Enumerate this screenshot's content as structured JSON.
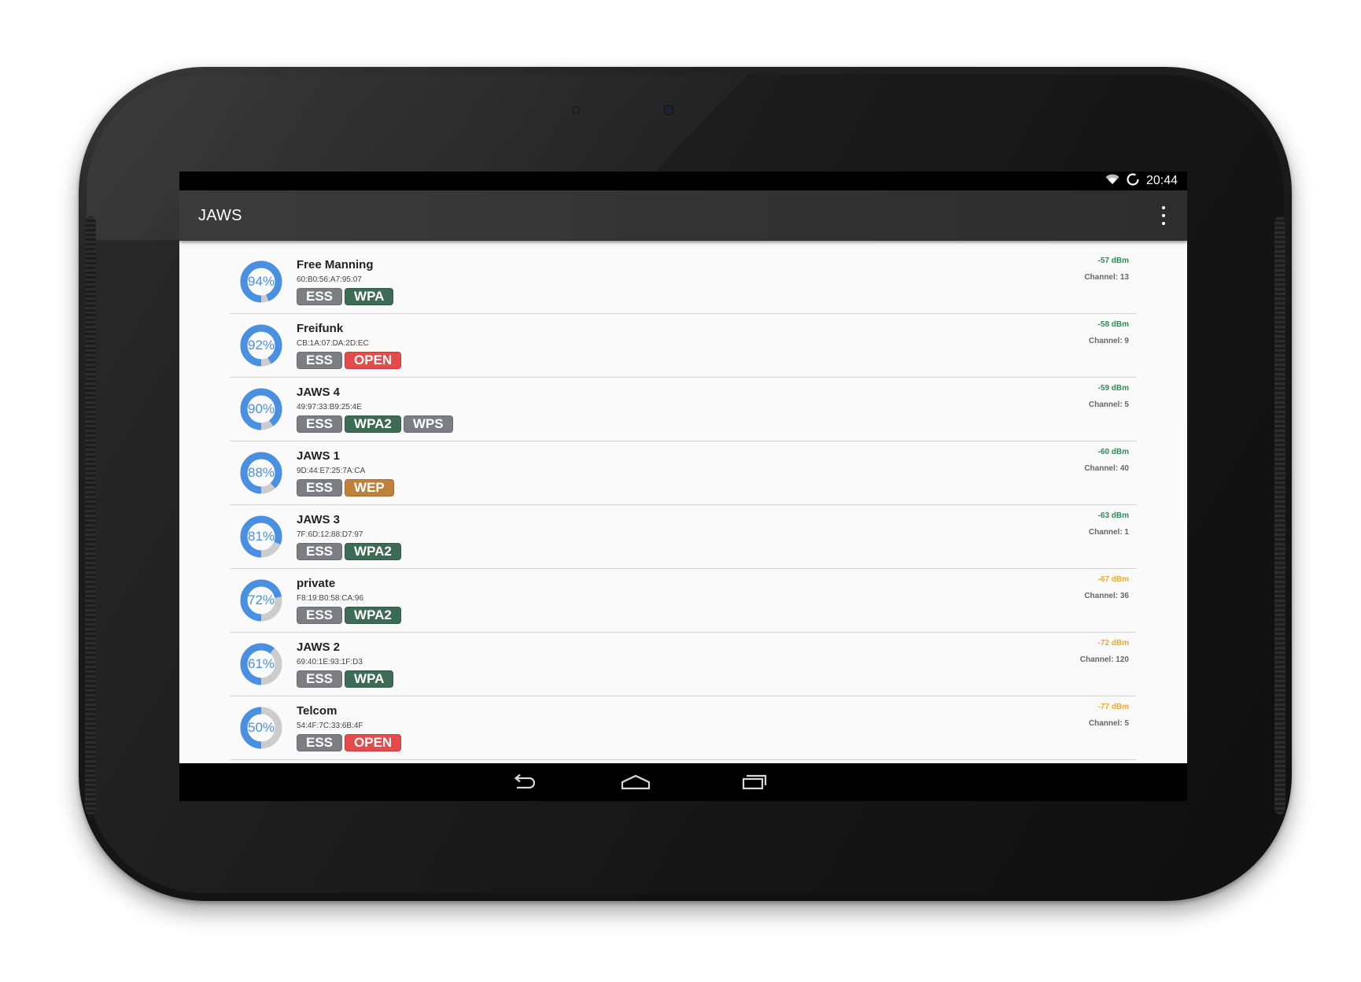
{
  "status_bar": {
    "time": "20:44"
  },
  "app": {
    "title": "JAWS"
  },
  "colors": {
    "ring_fill": "#4a90e2",
    "ring_track": "#cccccc",
    "badge_ess": "#7b7f83",
    "badge_wpa": "#3e6b55",
    "badge_wpa2": "#3e6b55",
    "badge_wps": "#7b7f83",
    "badge_open": "#e54b4b",
    "badge_wep": "#c0813a",
    "dbm_good": "#2e8b57",
    "dbm_fair": "#f0a830"
  },
  "networks": [
    {
      "ssid": "Free Manning",
      "bssid": "60:B0:56:A7:95:07",
      "signal_percent": 94,
      "signal_label": "94%",
      "dbm": "-57 dBm",
      "dbm_level": "good",
      "channel": "Channel: 13",
      "badges": [
        {
          "label": "ESS",
          "kind": "ess"
        },
        {
          "label": "WPA",
          "kind": "wpa"
        }
      ]
    },
    {
      "ssid": "Freifunk",
      "bssid": "CB:1A:07:DA:2D:EC",
      "signal_percent": 92,
      "signal_label": "92%",
      "dbm": "-58 dBm",
      "dbm_level": "good",
      "channel": "Channel: 9",
      "badges": [
        {
          "label": "ESS",
          "kind": "ess"
        },
        {
          "label": "OPEN",
          "kind": "open"
        }
      ]
    },
    {
      "ssid": "JAWS 4",
      "bssid": "49:97:33:B9:25:4E",
      "signal_percent": 90,
      "signal_label": "90%",
      "dbm": "-59 dBm",
      "dbm_level": "good",
      "channel": "Channel: 5",
      "badges": [
        {
          "label": "ESS",
          "kind": "ess"
        },
        {
          "label": "WPA2",
          "kind": "wpa2"
        },
        {
          "label": "WPS",
          "kind": "wps"
        }
      ]
    },
    {
      "ssid": "JAWS 1",
      "bssid": "9D:44:E7:25:7A:CA",
      "signal_percent": 88,
      "signal_label": "88%",
      "dbm": "-60 dBm",
      "dbm_level": "good",
      "channel": "Channel: 40",
      "badges": [
        {
          "label": "ESS",
          "kind": "ess"
        },
        {
          "label": "WEP",
          "kind": "wep"
        }
      ]
    },
    {
      "ssid": "JAWS 3",
      "bssid": "7F:6D:12:88:D7:97",
      "signal_percent": 81,
      "signal_label": "81%",
      "dbm": "-63 dBm",
      "dbm_level": "good",
      "channel": "Channel: 1",
      "badges": [
        {
          "label": "ESS",
          "kind": "ess"
        },
        {
          "label": "WPA2",
          "kind": "wpa2"
        }
      ]
    },
    {
      "ssid": "private",
      "bssid": "F8:19:B0:58:CA:96",
      "signal_percent": 72,
      "signal_label": "72%",
      "dbm": "-67 dBm",
      "dbm_level": "fair",
      "channel": "Channel: 36",
      "badges": [
        {
          "label": "ESS",
          "kind": "ess"
        },
        {
          "label": "WPA2",
          "kind": "wpa2"
        }
      ]
    },
    {
      "ssid": "JAWS 2",
      "bssid": "69:40:1E:93:1F:D3",
      "signal_percent": 61,
      "signal_label": "61%",
      "dbm": "-72 dBm",
      "dbm_level": "fair",
      "channel": "Channel: 120",
      "badges": [
        {
          "label": "ESS",
          "kind": "ess"
        },
        {
          "label": "WPA",
          "kind": "wpa"
        }
      ]
    },
    {
      "ssid": "Telcom",
      "bssid": "54:4F:7C:33:6B:4F",
      "signal_percent": 50,
      "signal_label": "50%",
      "dbm": "-77 dBm",
      "dbm_level": "fair",
      "channel": "Channel: 5",
      "badges": [
        {
          "label": "ESS",
          "kind": "ess"
        },
        {
          "label": "OPEN",
          "kind": "open"
        }
      ]
    }
  ],
  "icons": {
    "status": [
      "wifi-icon",
      "sync-icon"
    ],
    "actionbar": [
      "overflow-menu-icon"
    ],
    "navbar": [
      "back-icon",
      "home-icon",
      "recents-icon"
    ]
  }
}
